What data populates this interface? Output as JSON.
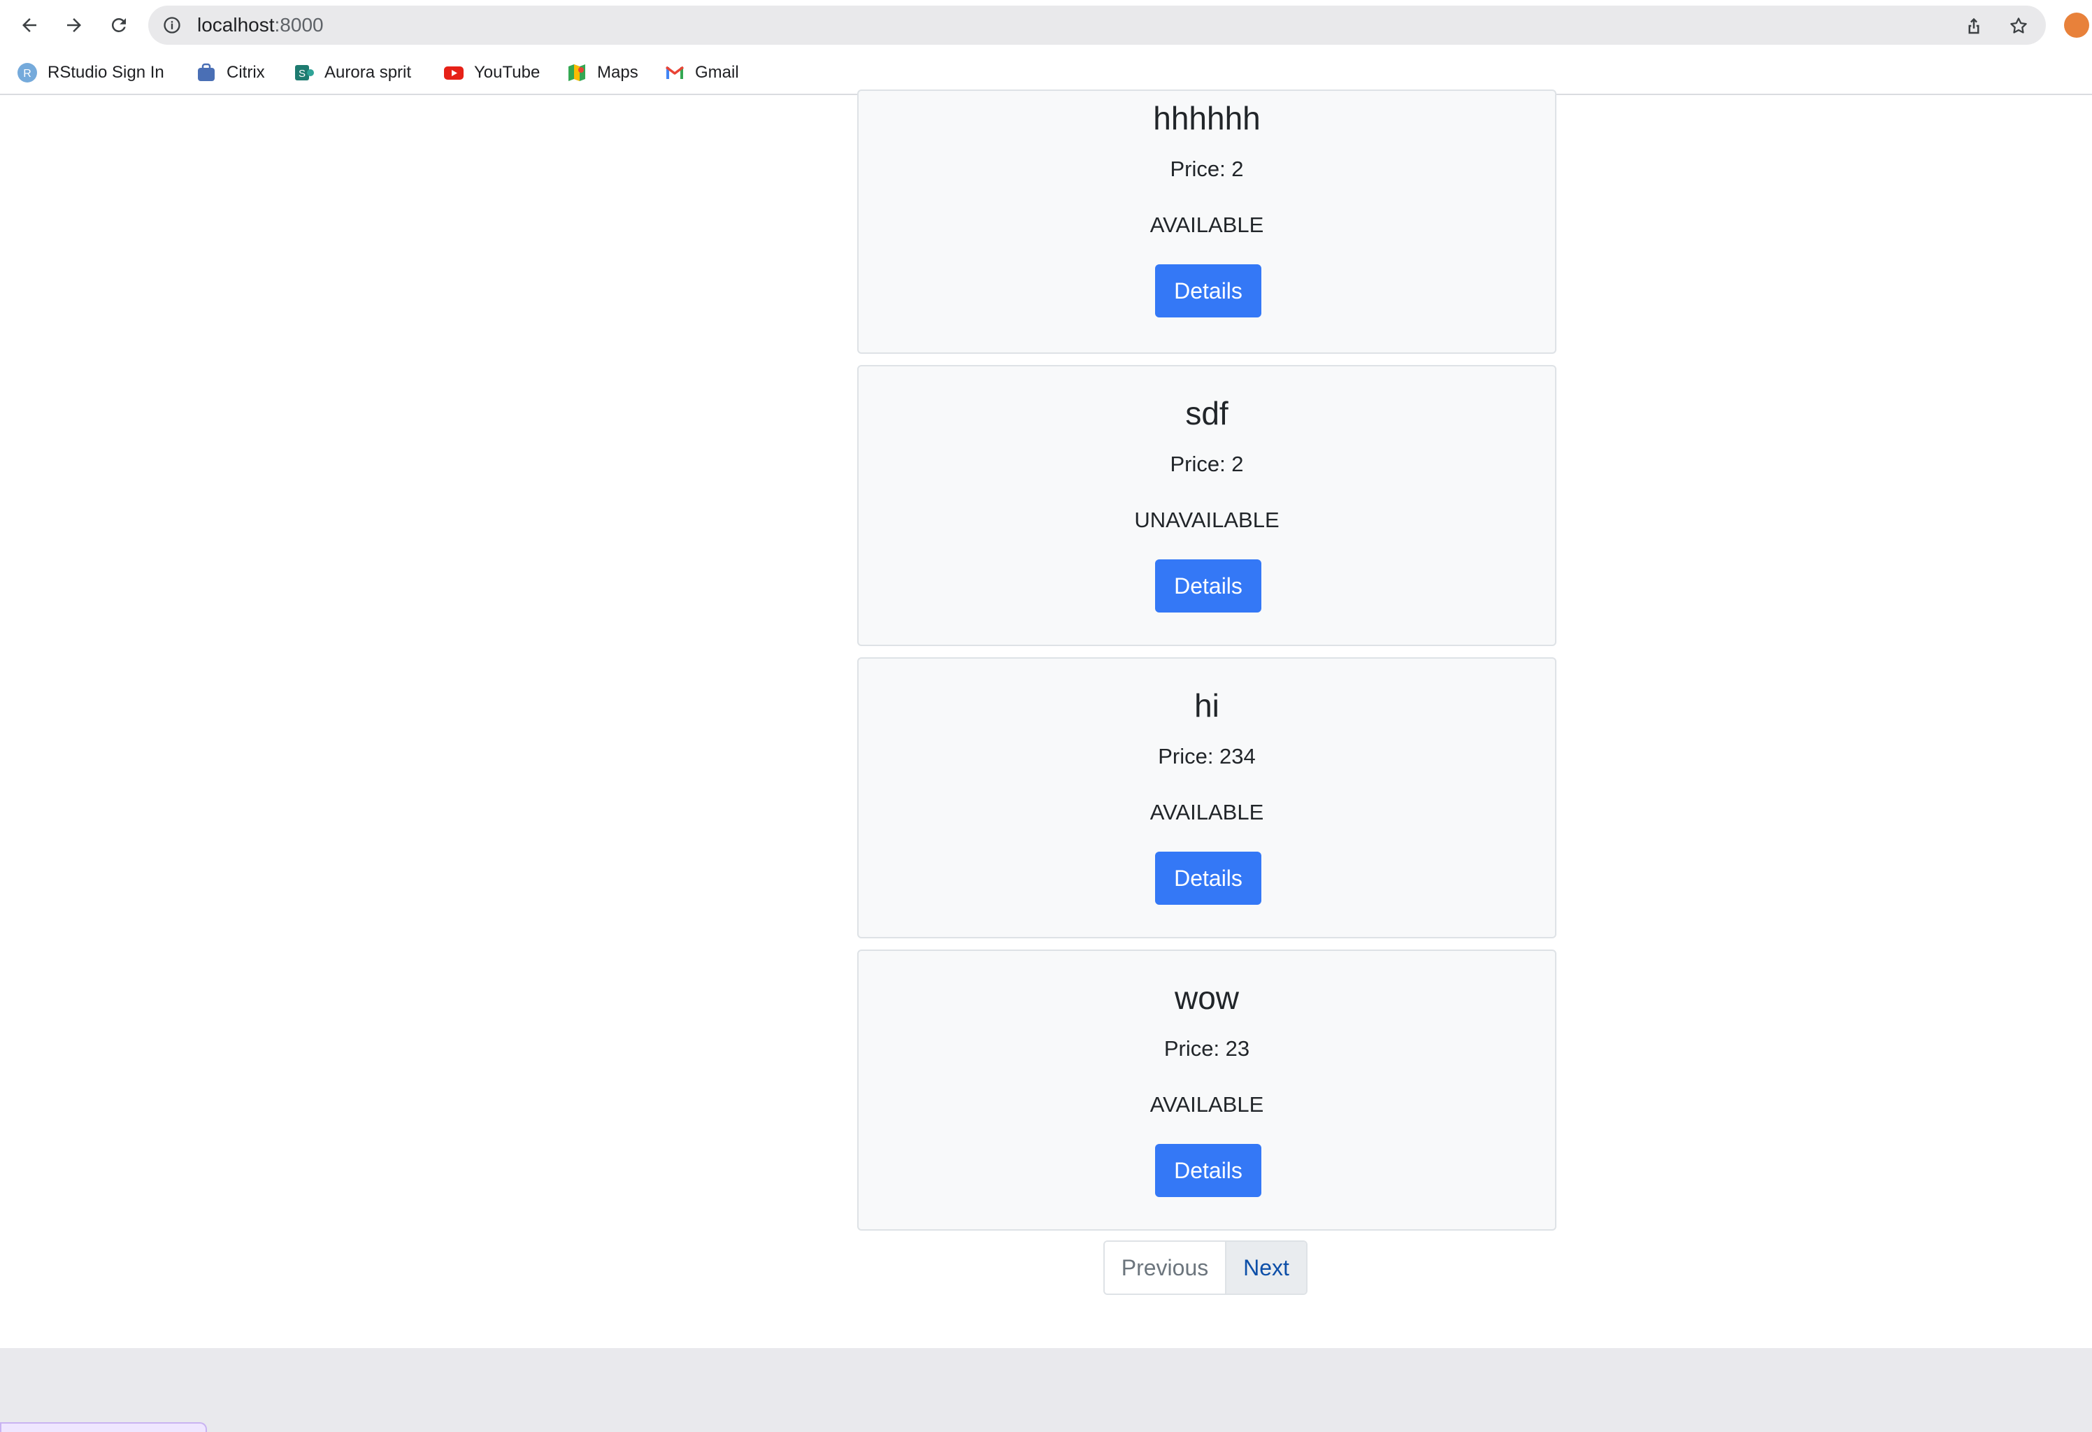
{
  "browser": {
    "url_host": "localhost",
    "url_port": ":8000",
    "bookmarks": [
      {
        "label": "RStudio Sign In",
        "icon": "rstudio-icon"
      },
      {
        "label": "Citrix",
        "icon": "citrix-icon"
      },
      {
        "label": "Aurora sprit",
        "icon": "aurora-icon"
      },
      {
        "label": "YouTube",
        "icon": "youtube-icon"
      },
      {
        "label": "Maps",
        "icon": "maps-icon"
      },
      {
        "label": "Gmail",
        "icon": "gmail-icon"
      }
    ]
  },
  "colors": {
    "button_blue": "#3478f6",
    "card_bg": "#f8f9fa",
    "next_link": "#0d4fa8"
  },
  "products": [
    {
      "name": "hhhhhh",
      "price": "Price: 2",
      "status": "AVAILABLE",
      "button": "Details"
    },
    {
      "name": "sdf",
      "price": "Price: 2",
      "status": "UNAVAILABLE",
      "button": "Details"
    },
    {
      "name": "hi",
      "price": "Price: 234",
      "status": "AVAILABLE",
      "button": "Details"
    },
    {
      "name": "wow",
      "price": "Price: 23",
      "status": "AVAILABLE",
      "button": "Details"
    }
  ],
  "pagination": {
    "previous": "Previous",
    "next": "Next"
  }
}
